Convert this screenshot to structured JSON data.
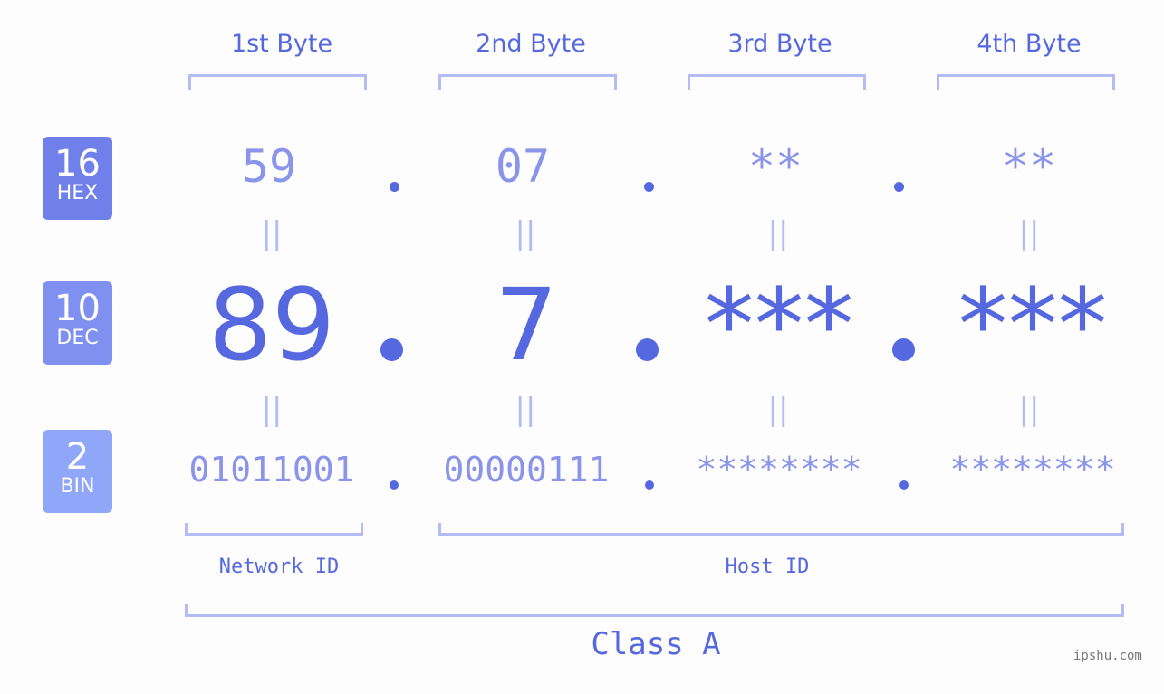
{
  "bytes": [
    {
      "label": "1st Byte",
      "hex": "59",
      "dec": "89",
      "bin": "01011001"
    },
    {
      "label": "2nd Byte",
      "hex": "07",
      "dec": "7",
      "bin": "00000111"
    },
    {
      "label": "3rd Byte",
      "hex": "**",
      "dec": "***",
      "bin": "********"
    },
    {
      "label": "4th Byte",
      "hex": "**",
      "dec": "***",
      "bin": "********"
    }
  ],
  "bases": [
    {
      "num": "16",
      "label": "HEX",
      "color": "#7080ea"
    },
    {
      "num": "10",
      "label": "DEC",
      "color": "#8090f0"
    },
    {
      "num": "2",
      "label": "BIN",
      "color": "#90a6f8"
    }
  ],
  "equals": "||",
  "network_label": "Network ID",
  "host_label": "Host ID",
  "class_label": "Class A",
  "watermark": "ipshu.com"
}
